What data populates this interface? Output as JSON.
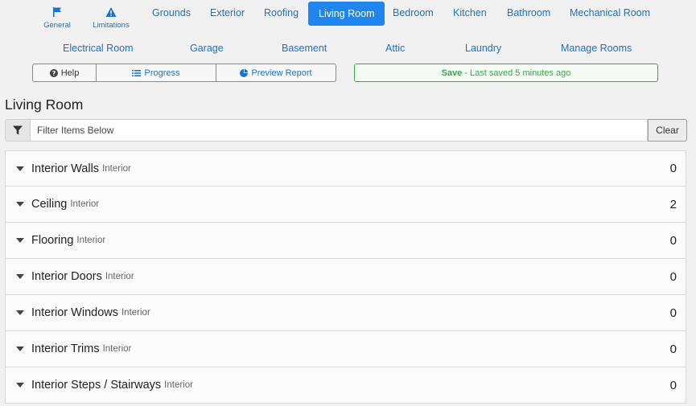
{
  "nav": {
    "icon_items": [
      {
        "label": "General",
        "icon": "flag-icon"
      },
      {
        "label": "Limitations",
        "icon": "warning-icon"
      }
    ],
    "row1": [
      "Grounds",
      "Exterior",
      "Roofing",
      "Living Room",
      "Bedroom",
      "Kitchen",
      "Bathroom",
      "Mechanical Room"
    ],
    "row2": [
      "Electrical Room",
      "Garage",
      "Basement",
      "Attic",
      "Laundry",
      "Manage Rooms"
    ],
    "active": "Living Room"
  },
  "toolbar": {
    "help_label": "Help",
    "progress_label": "Progress",
    "preview_label": "Preview Report"
  },
  "save": {
    "label": "Save",
    "status": "- Last saved 5 minutes ago"
  },
  "page": {
    "title": "Living Room"
  },
  "filter": {
    "placeholder": "Filter Items Below",
    "value": "",
    "clear_label": "Clear"
  },
  "items": [
    {
      "title": "Interior Walls",
      "category": "Interior",
      "count": "0"
    },
    {
      "title": "Ceiling",
      "category": "Interior",
      "count": "2"
    },
    {
      "title": "Flooring",
      "category": "Interior",
      "count": "0"
    },
    {
      "title": "Interior Doors",
      "category": "Interior",
      "count": "0"
    },
    {
      "title": "Interior Windows",
      "category": "Interior",
      "count": "0"
    },
    {
      "title": "Interior Trims",
      "category": "Interior",
      "count": "0"
    },
    {
      "title": "Interior Steps / Stairways",
      "category": "Interior",
      "count": "0"
    }
  ],
  "colors": {
    "accent": "#1f86f0",
    "link": "#1a73c9",
    "success": "#3aa745"
  }
}
